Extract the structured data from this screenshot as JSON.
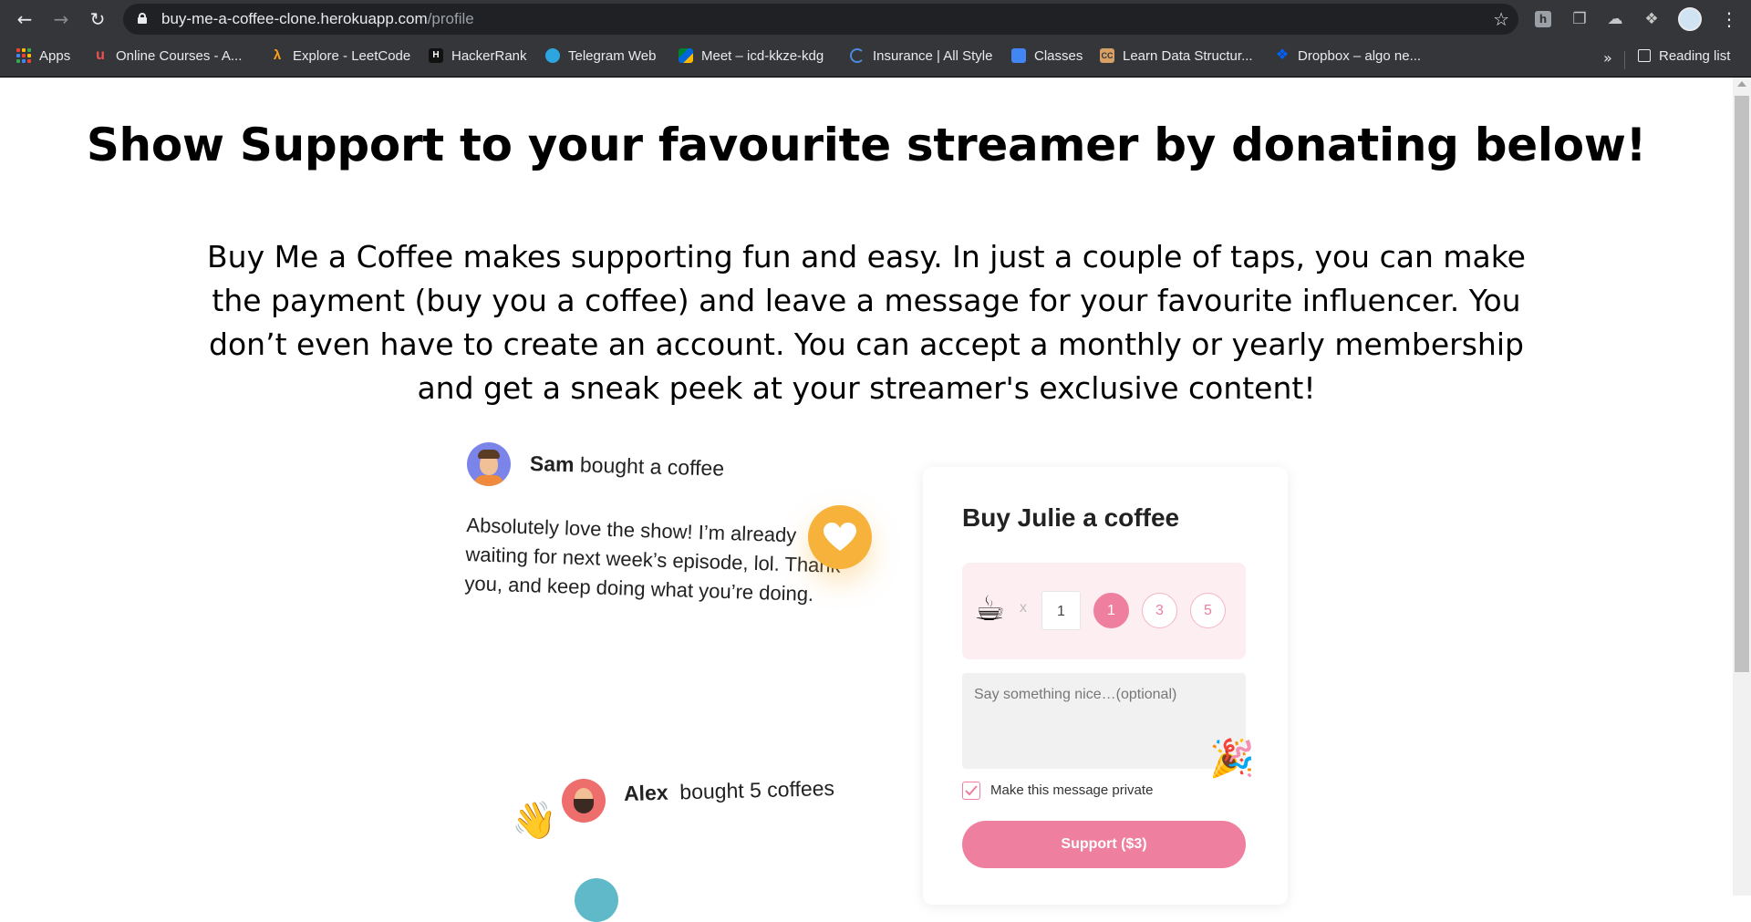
{
  "browser": {
    "url_domain": "buy-me-a-coffee-clone.herokuapp.com",
    "url_path": "/profile",
    "bookmarks": [
      {
        "label": "Apps",
        "icon": "apps-grid-icon"
      },
      {
        "label": "Online Courses - A...",
        "icon": "udemy-icon"
      },
      {
        "label": "Explore - LeetCode",
        "icon": "leetcode-icon"
      },
      {
        "label": "HackerRank",
        "icon": "hackerrank-icon"
      },
      {
        "label": "Telegram Web",
        "icon": "telegram-icon"
      },
      {
        "label": "Meet – icd-kkze-kdg",
        "icon": "meet-icon"
      },
      {
        "label": "Insurance | All Style",
        "icon": "insurance-icon"
      },
      {
        "label": "Classes",
        "icon": "classroom-icon"
      },
      {
        "label": "Learn Data Structur...",
        "icon": "cc-icon"
      },
      {
        "label": "Dropbox – algo ne...",
        "icon": "dropbox-icon"
      }
    ],
    "overflow_glyph": "»",
    "reading_list": "Reading list"
  },
  "page": {
    "headline": "Show Support to your favourite streamer by donating below!",
    "intro": "Buy Me a Coffee makes supporting fun and easy. In just a couple of taps, you can make the payment (buy you a coffee) and leave a message for your favourite influencer. You don’t even have to create an account. You can accept a monthly or yearly membership and get a sneak peek at your streamer's exclusive content!"
  },
  "feed": [
    {
      "name": "Sam",
      "action": "bought a coffee",
      "message": "Absolutely love the show! I’m already waiting for next week’s episode, lol. Thank you, and keep doing what you’re doing."
    },
    {
      "name": "Alex",
      "action": "bought 5 coffees"
    }
  ],
  "card": {
    "title": "Buy Julie a coffee",
    "times": "x",
    "quantity": "1",
    "chips": [
      "1",
      "3",
      "5"
    ],
    "selected_chip": "1",
    "message_placeholder": "Say something nice…(optional)",
    "private_label": "Make this message private",
    "private_checked": true,
    "button": "Support ($3)"
  },
  "colors": {
    "accent_pink": "#ef7f9f",
    "heart_badge": "#f7b23b",
    "chrome_bg": "#35363a"
  }
}
